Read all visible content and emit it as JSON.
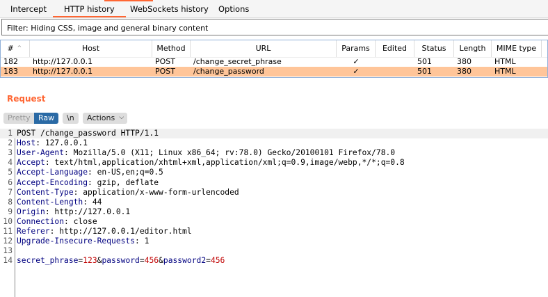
{
  "tabs": [
    "Intercept",
    "HTTP history",
    "WebSockets history",
    "Options"
  ],
  "filter": "Filter: Hiding CSS, image and general binary content",
  "columns": [
    "#",
    "Host",
    "Method",
    "URL",
    "Params",
    "Edited",
    "Status",
    "Length",
    "MIME type"
  ],
  "sort_icon": "chevron-up-icon",
  "rows": [
    {
      "num": "182",
      "host": "http://127.0.0.1",
      "method": "POST",
      "url": "/change_secret_phrase",
      "params": "✓",
      "edited": "",
      "status": "501",
      "length": "380",
      "mime": "HTML"
    },
    {
      "num": "183",
      "host": "http://127.0.0.1",
      "method": "POST",
      "url": "/change_password",
      "params": "✓",
      "edited": "",
      "status": "501",
      "length": "380",
      "mime": "HTML"
    }
  ],
  "request": {
    "title": "Request",
    "buttons": {
      "pretty": "Pretty",
      "raw": "Raw",
      "newline": "\\n",
      "actions": "Actions"
    },
    "lines": [
      {
        "n": "1",
        "k": "POST /change_password HTTP/1.1",
        "v": ""
      },
      {
        "n": "2",
        "k": "Host",
        "v": ": 127.0.0.1"
      },
      {
        "n": "3",
        "k": "User-Agent",
        "v": ": Mozilla/5.0 (X11; Linux x86_64; rv:78.0) Gecko/20100101 Firefox/78.0"
      },
      {
        "n": "4",
        "k": "Accept",
        "v": ": text/html,application/xhtml+xml,application/xml;q=0.9,image/webp,*/*;q=0.8"
      },
      {
        "n": "5",
        "k": "Accept-Language",
        "v": ": en-US,en;q=0.5"
      },
      {
        "n": "6",
        "k": "Accept-Encoding",
        "v": ": gzip, deflate"
      },
      {
        "n": "7",
        "k": "Content-Type",
        "v": ": application/x-www-form-urlencoded"
      },
      {
        "n": "8",
        "k": "Content-Length",
        "v": ": 44"
      },
      {
        "n": "9",
        "k": "Origin",
        "v": ": http://127.0.0.1"
      },
      {
        "n": "10",
        "k": "Connection",
        "v": ": close"
      },
      {
        "n": "11",
        "k": "Referer",
        "v": ": http://127.0.0.1/editor.html"
      },
      {
        "n": "12",
        "k": "Upgrade-Insecure-Requests",
        "v": ": 1"
      },
      {
        "n": "13",
        "k": "",
        "v": ""
      }
    ],
    "body": {
      "n": "14",
      "parts": [
        [
          "secret_phrase",
          "=",
          "123",
          "&"
        ],
        [
          "password",
          "=",
          "456",
          "&"
        ],
        [
          "password2",
          "=",
          "456",
          ""
        ]
      ]
    }
  }
}
